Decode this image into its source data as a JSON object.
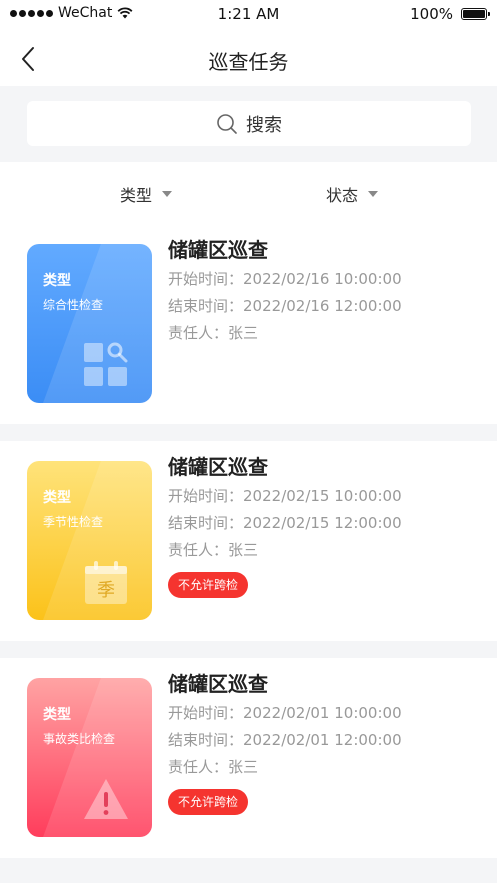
{
  "status_bar": {
    "carrier": "WeChat",
    "time": "1:21 AM",
    "battery": "100%"
  },
  "nav": {
    "title": "巡查任务"
  },
  "search": {
    "label": "搜索"
  },
  "filters": {
    "type_label": "类型",
    "status_label": "状态"
  },
  "tasks": [
    {
      "thumb_type": "类型",
      "category": "综合性检查",
      "icon": "grid-search-icon",
      "color": "#3b8df5",
      "title": "储罐区巡查",
      "start_label": "开始时间：",
      "start": "2022/02/16 10:00:00",
      "end_label": "结束时间：",
      "end": "2022/02/16 12:00:00",
      "owner_label": "责任人：",
      "owner": "张三",
      "tag": ""
    },
    {
      "thumb_type": "类型",
      "category": "季节性检查",
      "icon": "calendar-season-icon",
      "color": "#fbc21a",
      "title": "储罐区巡查",
      "start_label": "开始时间：",
      "start": "2022/02/15 10:00:00",
      "end_label": "结束时间：",
      "end": "2022/02/15 12:00:00",
      "owner_label": "责任人：",
      "owner": "张三",
      "tag": "不允许跨检",
      "calendar_char": "季"
    },
    {
      "thumb_type": "类型",
      "category": "事故类比检查",
      "icon": "warning-triangle-icon",
      "color": "#ff3d5c",
      "title": "储罐区巡查",
      "start_label": "开始时间：",
      "start": "2022/02/01 10:00:00",
      "end_label": "结束时间：",
      "end": "2022/02/01 12:00:00",
      "owner_label": "责任人：",
      "owner": "张三",
      "tag": "不允许跨检"
    }
  ]
}
